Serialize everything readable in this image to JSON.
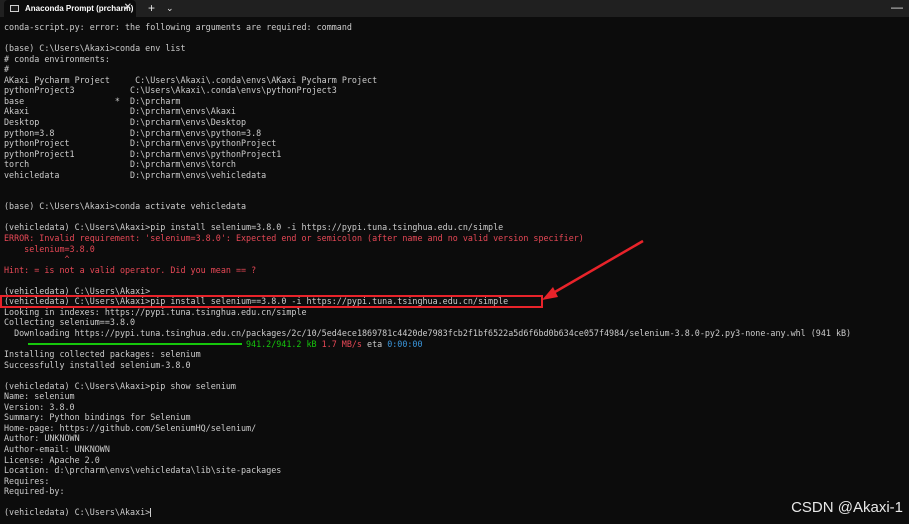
{
  "window": {
    "tab_title": "Anaconda Prompt (prcharm)",
    "close_glyph": "✕",
    "new_tab_glyph": "+",
    "dropdown_glyph": "⌄",
    "minimize_glyph": "—"
  },
  "terminal": {
    "lines": [
      "conda-script.py: error: the following arguments are required: command",
      "",
      "(base) C:\\Users\\Akaxi>conda env list",
      "# conda environments:",
      "#",
      "AKaxi Pycharm Project     C:\\Users\\Akaxi\\.conda\\envs\\AKaxi Pycharm Project",
      "pythonProject3           C:\\Users\\Akaxi\\.conda\\envs\\pythonProject3",
      "base                  *  D:\\prcharm",
      "Akaxi                    D:\\prcharm\\envs\\Akaxi",
      "Desktop                  D:\\prcharm\\envs\\Desktop",
      "python=3.8               D:\\prcharm\\envs\\python=3.8",
      "pythonProject            D:\\prcharm\\envs\\pythonProject",
      "pythonProject1           D:\\prcharm\\envs\\pythonProject1",
      "torch                    D:\\prcharm\\envs\\torch",
      "vehicledata              D:\\prcharm\\envs\\vehicledata",
      "",
      "",
      "(base) C:\\Users\\Akaxi>conda activate vehicledata",
      "",
      "(vehicledata) C:\\Users\\Akaxi>pip install selenium=3.8.0 -i https://pypi.tuna.tsinghua.edu.cn/simple",
      "ERROR: Invalid requirement: 'selenium=3.8.0': Expected end or semicolon (after name and no valid version specifier)",
      "    selenium=3.8.0",
      "            ^",
      "Hint: = is not a valid operator. Did you mean == ?",
      "",
      "(vehicledata) C:\\Users\\Akaxi>",
      "(vehicledata) C:\\Users\\Akaxi>pip install selenium==3.8.0 -i https://pypi.tuna.tsinghua.edu.cn/simple",
      "Looking in indexes: https://pypi.tuna.tsinghua.edu.cn/simple",
      "Collecting selenium==3.8.0",
      "  Downloading https://pypi.tuna.tsinghua.edu.cn/packages/2c/10/5ed4ece1869781c4420de7983fcb2f1bf6522a5d6f6bd0b634ce057f4984/selenium-3.8.0-py2.py3-none-any.whl (941 kB)",
      "",
      "Installing collected packages: selenium",
      "Successfully installed selenium-3.8.0",
      "",
      "(vehicledata) C:\\Users\\Akaxi>pip show selenium",
      "Name: selenium",
      "Version: 3.8.0",
      "Summary: Python bindings for Selenium",
      "Home-page: https://github.com/SeleniumHQ/selenium/",
      "Author: UNKNOWN",
      "Author-email: UNKNOWN",
      "License: Apache 2.0",
      "Location: d:\\prcharm\\envs\\vehicledata\\lib\\site-packages",
      "Requires:",
      "Required-by:",
      "",
      "(vehicledata) C:\\Users\\Akaxi>"
    ],
    "progress": {
      "fraction": 1.0,
      "size_text": "941.2/941.2 kB",
      "speed_text": "1.7 MB/s",
      "eta_label": "eta",
      "eta_value": "0:00:00"
    }
  },
  "colors": {
    "background": "#0c0c0c",
    "text": "#cccccc",
    "error": "#e74856",
    "progress": "#16c60c",
    "annotation": "#e8232a"
  },
  "watermark": "CSDN @Akaxi-1"
}
